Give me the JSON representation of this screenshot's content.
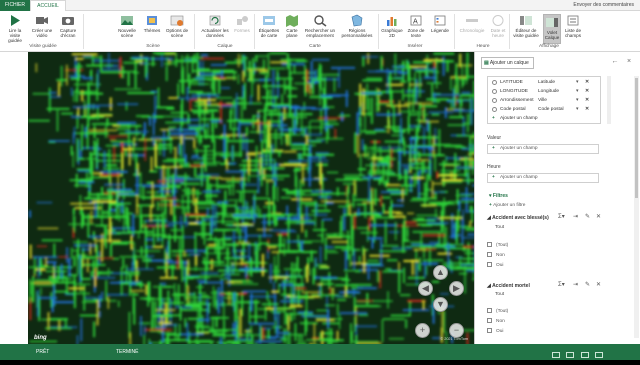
{
  "tabs": {
    "file": "FICHIER",
    "home": "ACCUEIL"
  },
  "feedback": "Envoyer des commentaires",
  "ribbon": {
    "groups": {
      "visite_guidee": "Visite guidée",
      "scene": "Scène",
      "calque": "Calque",
      "carte": "Carte",
      "inserer": "Insérer",
      "heure": "Heure",
      "affichage": "Affichage"
    },
    "buttons": {
      "play": "Lire la visite guidée",
      "create_video": "Créer une vidéo",
      "capture": "Capture d'écran",
      "new_scene": "Nouvelle scène",
      "themes": "Thèmes",
      "scene_options": "Options de scène",
      "refresh": "Actualiser les données",
      "shapes": "Formes",
      "map_labels": "Étiquettes de carte",
      "flat_map": "Carte plane",
      "find_location": "Rechercher un emplacement",
      "custom_regions": "Régions personnalisées",
      "chart_2d": "Graphique 2D",
      "text_box": "Zone de texte",
      "legend": "Légende",
      "timeline": "Chronologie",
      "date_time": "Date et heure",
      "tour_editor": "Éditeur de visite guidée",
      "layer_pane": "Volet Calque",
      "field_list": "Liste de champs"
    }
  },
  "map": {
    "bing": "bing",
    "copyright": "© 2021 TomTom",
    "nav": {
      "up": "▲",
      "down": "▼",
      "left": "◀",
      "right": "▶",
      "zoom_in": "+",
      "zoom_out": "−"
    }
  },
  "panel": {
    "add_layer": "Ajouter un calque",
    "fields": [
      {
        "name": "LATITUDE",
        "type": "Latitude"
      },
      {
        "name": "LONGITUDE",
        "type": "Longitude"
      },
      {
        "name": "Arrondissement",
        "type": "Ville"
      },
      {
        "name": "Code postal",
        "type": "Code postal"
      }
    ],
    "add_field": "Ajouter un champ",
    "valeur_label": "Valeur",
    "heure_label": "Heure",
    "filters_label": "Filtres",
    "add_filter": "Ajouter un filtre",
    "filter1": {
      "name": "Accident avec blessé(s)",
      "value": "Tout",
      "options": [
        "(Tout)",
        "Non",
        "Oui"
      ]
    },
    "filter2": {
      "name": "Accident mortel",
      "value": "Tout",
      "options": [
        "(Tout)",
        "Non",
        "Oui"
      ]
    }
  },
  "status": {
    "ready": "PRÊT",
    "done": "TERMINÉ"
  },
  "colors": {
    "accent": "#217346",
    "heat_low": "#1f6fd6",
    "heat_mid": "#2fd63a",
    "heat_high": "#e8e02a",
    "heat_max": "#d8281c"
  }
}
